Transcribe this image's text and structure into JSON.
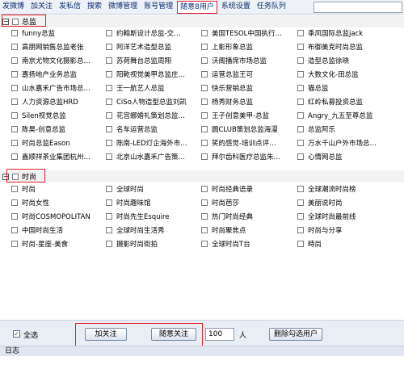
{
  "menu": {
    "items": [
      "发微博",
      "加关注",
      "发私信",
      "搜索",
      "微博管理",
      "账号管理",
      "随意8用户",
      "系统设置",
      "任务队列"
    ],
    "active_index": 6,
    "active_color": "#e0212b"
  },
  "groups": [
    {
      "title": "总监",
      "expander": "−",
      "items": [
        "funny总监",
        "约翰斯设计总监-交…",
        "美国TESOL中国执行…",
        "季凤国际总监jack",
        "高朋网销售总监老张",
        "阿洋艺术造型总监",
        "上影形象总监",
        "布御美克时尚总监",
        "南京尤物文化摄影总…",
        "苏荷舞台总监周翔",
        "沃阁播席市场总监",
        "造型总监徐晓",
        "嘉扬地产业务总监",
        "阳乾视觉美甲总监庄…",
        "运营总监王可",
        "大数文化-田总监",
        "山水嘉禾广告市场总…",
        "王一航艺人总监",
        "快乐营销总监",
        "猫总监",
        "人力资源总监HRD",
        "CiSo人物造型总监刘凯",
        "杨秀财务总监",
        "红岭私募投资总监",
        "Silen视觉总监",
        "花宫娜婚礼策划总监…",
        "王子创意美甲-总监",
        "Angry_九五至尊总监",
        "陈昊-创意总监",
        "名车运营总监",
        "圆CLUB策划总监海漫",
        "总监阿乐",
        "时尚总监Eason",
        "陈南-LED灯企海外市…",
        "笑的感觉-培训点评…",
        "万水千山户外市场总…",
        "鑫顺祥茶业集团杭州…",
        "北京山水嘉禾广告策…",
        "拜尔齿科医疗总监朱…",
        "心情网总监"
      ]
    },
    {
      "title": "时尚",
      "expander": "−",
      "items": [
        "时尚",
        "全球时尚",
        "时尚经典语录",
        "全球潮流时尚榜",
        "时尚女性",
        "时尚趣味馆",
        "时尚芭莎",
        "美丽说时尚",
        "时尚COSMOPOLITAN",
        "时尚先生Esquire",
        "热门时尚经典",
        "全球时尚最前线",
        "中国时尚生活",
        "全球时尚生活秀",
        "时尚聚焦点",
        "时尚与分享",
        "时尚-星座-美食",
        "摄影时尚街拍",
        "全球时尚T台",
        "時尚"
      ]
    }
  ],
  "footer": {
    "select_all_label": "全选",
    "select_all_checked": "✓",
    "follow_button": "加关注",
    "random_follow_button": "随意关注",
    "count_value": "100",
    "count_unit": "人",
    "delete_button": "删除勾选用户"
  },
  "log": {
    "title": "日志"
  }
}
